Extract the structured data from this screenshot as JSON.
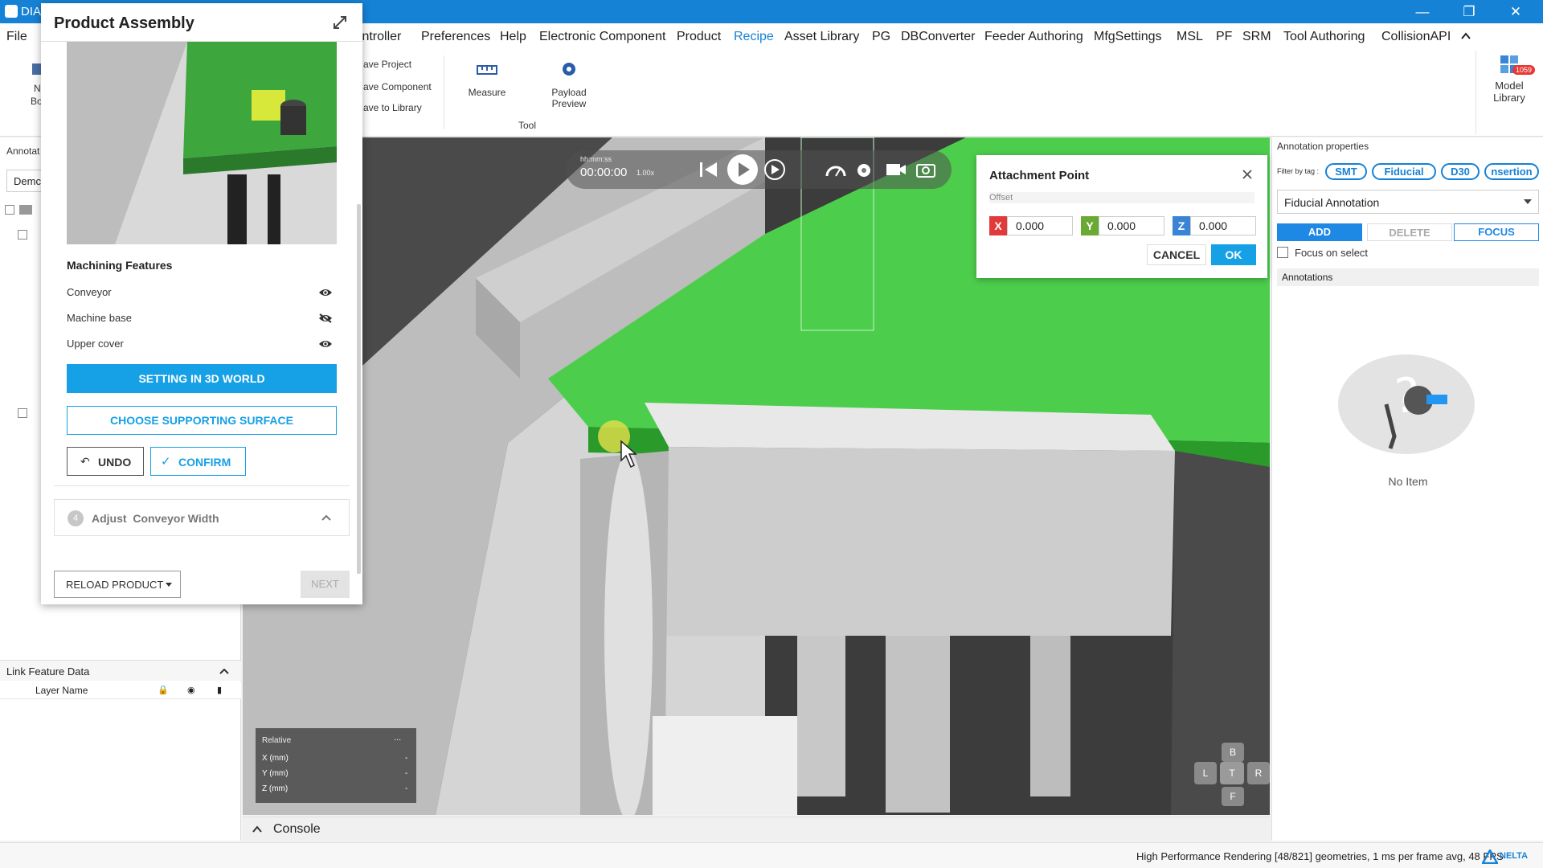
{
  "window": {
    "title": "DIA",
    "minimize": "—",
    "restore": "❐",
    "close": "✕"
  },
  "menu": {
    "items": [
      "File",
      "Controller",
      "Preferences",
      "Help",
      "Electronic Component",
      "Product",
      "Recipe",
      "Asset Library",
      "PG",
      "DBConverter",
      "Feeder Authoring",
      "MfgSettings",
      "MSL",
      "PF",
      "SRM",
      "Tool Authoring",
      "CollisionAPI"
    ],
    "active": "Recipe",
    "collapse_icon": "chevron-up-icon"
  },
  "ribbon": {
    "save_project": "ave Project",
    "save_component": "ave Component",
    "save_to_library": "ave to Library",
    "measure": "Measure",
    "payload_preview_1": "Payload",
    "payload_preview_2": "Preview",
    "tool_group": "Tool",
    "model_library_1": "Model",
    "model_library_2": "Library",
    "model_library_badge": "1059",
    "new_board_1": "N",
    "new_board_2": "Bo"
  },
  "left_panel": {
    "annotations_header": "Annotat",
    "combo_value": "Demc",
    "link_feature_title": "Link Feature Data",
    "layer_name_col": "Layer Name"
  },
  "product_assembly": {
    "title": "Product Assembly",
    "machining_features_title": "Machining Features",
    "features": [
      {
        "name": "Conveyor",
        "visible": true
      },
      {
        "name": "Machine base",
        "visible": false
      },
      {
        "name": "Upper cover",
        "visible": true
      }
    ],
    "setting_3d_world": "SETTING IN 3D WORLD",
    "choose_surface": "CHOOSE SUPPORTING SURFACE",
    "undo": "UNDO",
    "confirm": "CONFIRM",
    "step_number": "4",
    "step_label": "Adjust  Conveyor Width",
    "reload_product": "RELOAD PRODUCT",
    "next": "NEXT"
  },
  "player": {
    "time_format": "hh:mm:ss",
    "time": "00:00:00",
    "speed": "1.00x"
  },
  "attachment_point": {
    "title": "Attachment Point",
    "offset_label": "Offset",
    "x_label": "X",
    "x_value": "0.000",
    "y_label": "Y",
    "y_value": "0.000",
    "z_label": "Z",
    "z_value": "0.000",
    "cancel": "CANCEL",
    "ok": "OK"
  },
  "relative_box": {
    "title": "Relative",
    "menu": "...",
    "rows": [
      {
        "label": "X (mm)",
        "value": "-"
      },
      {
        "label": "Y (mm)",
        "value": "-"
      },
      {
        "label": "Z (mm)",
        "value": "-"
      }
    ]
  },
  "view_cube": {
    "back": "B",
    "left": "L",
    "top": "T",
    "right": "R",
    "front": "F"
  },
  "annotation_properties": {
    "title": "Annotation properties",
    "filter_label": "Filter by tag :",
    "tags": [
      "SMT",
      "Fiducial",
      "D30",
      "nsertion"
    ],
    "type_value": "Fiducial Annotation",
    "add": "ADD",
    "delete": "DELETE",
    "focus": "FOCUS",
    "focus_on_select": "Focus on select",
    "annotations_header": "Annotations",
    "empty_text": "No Item"
  },
  "console": {
    "label": "Console"
  },
  "status": {
    "text": "High Performance Rendering [48/821] geometries, 1 ms per frame avg, 48 FPS",
    "brand": "NELTA"
  },
  "colors": {
    "accent": "#1682d6",
    "button_blue": "#16a0e6",
    "pcb_green": "#4cce4c",
    "x_red": "#e03a3a",
    "y_green": "#6aa933",
    "z_blue": "#3a84d6"
  }
}
